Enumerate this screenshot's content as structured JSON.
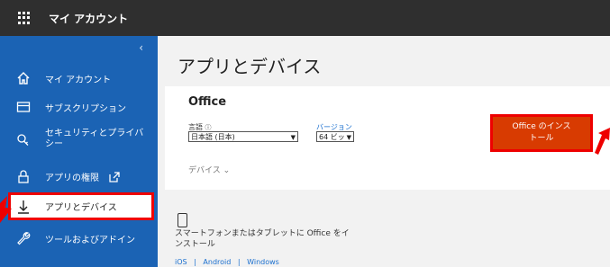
{
  "header": {
    "title": "マイ アカウント"
  },
  "sidebar": {
    "items": [
      {
        "label": "マイ アカウント",
        "icon": "home-icon"
      },
      {
        "label": "サブスクリプション",
        "icon": "card-icon"
      },
      {
        "label_line1": "セキュリティとプライバ",
        "label_line2": "シー",
        "icon": "key-icon"
      },
      {
        "label": "アプリの権限",
        "icon": "lock-icon"
      },
      {
        "label": "アプリとデバイス",
        "icon": "download-icon"
      },
      {
        "label": "ツールおよびアドイン",
        "icon": "wrench-icon"
      }
    ]
  },
  "main": {
    "title": "アプリとデバイス",
    "office": {
      "title": "Office",
      "language_label": "言語",
      "language_value": "日本語 (日本)",
      "version_label": "バージョン",
      "version_value": "64 ビッ",
      "install_line1": "Office のインス",
      "install_line2": "トール",
      "devices_label": "デバイス"
    },
    "mobile": {
      "text_line1": "スマートフォンまたはタブレットに Office をイ",
      "text_line2": "ンストール",
      "link_ios": "iOS",
      "link_android": "Android",
      "link_windows": "Windows",
      "separator": "|"
    }
  },
  "colors": {
    "sidebar": "#1b63b4",
    "install": "#d83b01",
    "highlight": "#ee0000"
  }
}
